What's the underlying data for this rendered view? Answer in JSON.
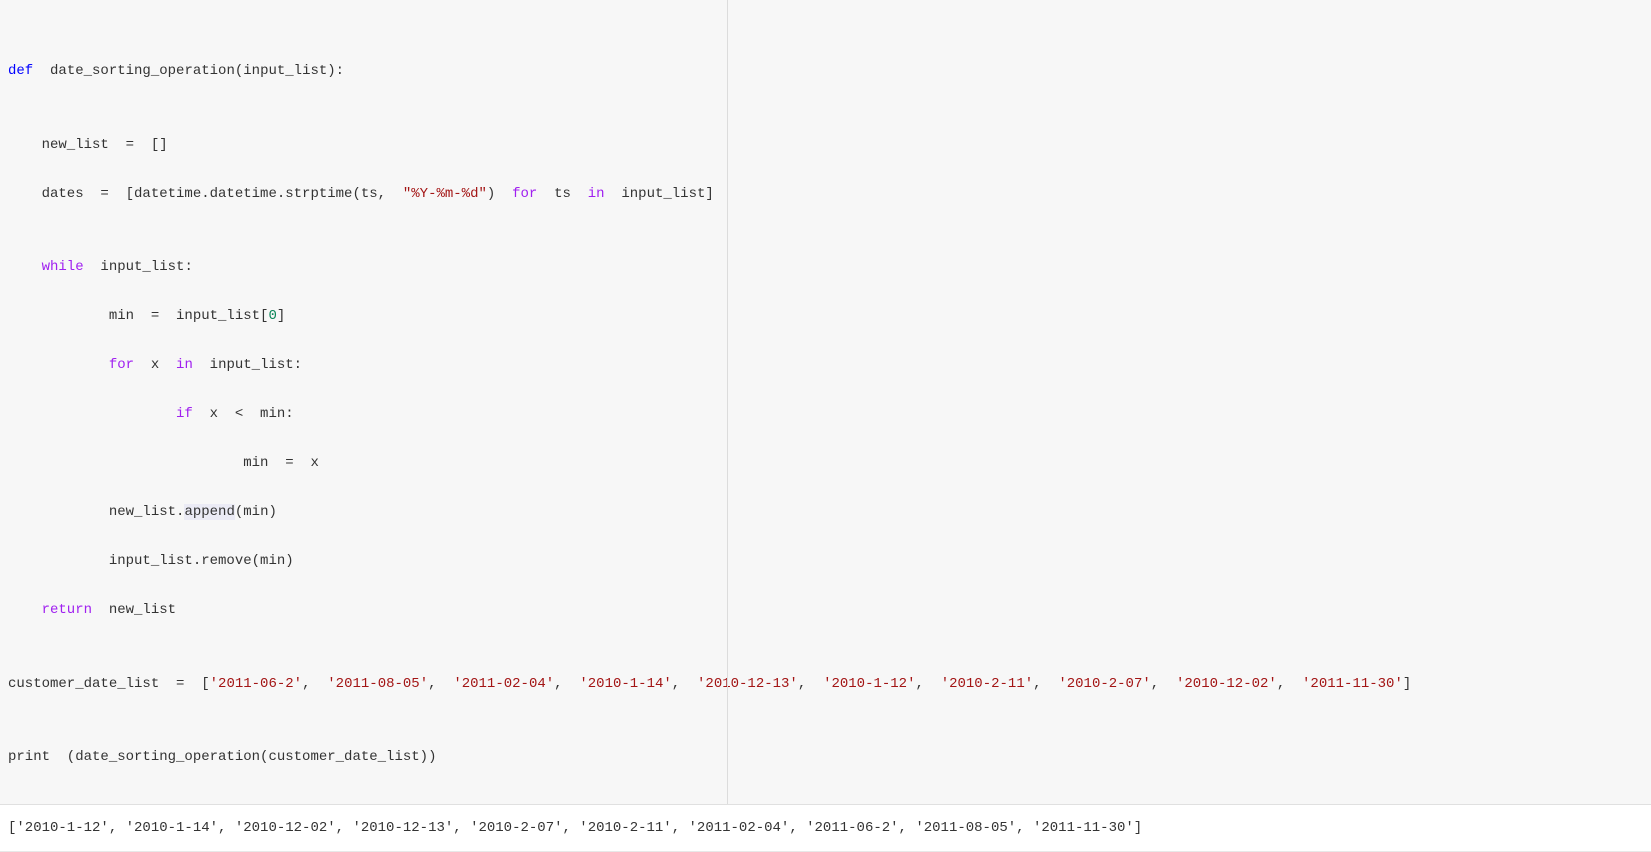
{
  "code": {
    "l1_def": "def",
    "l1_name": "  date_sorting_operation",
    "l1_rest": "(input_list):",
    "l2": "",
    "l3_a": "    new_list  =  []",
    "l4_a": "    dates  =  [datetime.datetime.strptime(ts,  ",
    "l4_str": "\"%Y-%m-%d\"",
    "l4_b": ")  ",
    "l4_for": "for",
    "l4_c": "  ts  ",
    "l4_in": "in",
    "l4_d": "  input_list]",
    "l5": "",
    "l6_while": "    while",
    "l6_rest": "  input_list:",
    "l7_a": "            min  =  input_list[",
    "l7_num": "0",
    "l7_b": "]",
    "l8_for": "            for",
    "l8_a": "  x  ",
    "l8_in": "in",
    "l8_b": "  input_list:",
    "l9_if": "                    if",
    "l9_rest": "  x  <  min:",
    "l10": "                            min  =  x",
    "l11_a": "            new_list.",
    "l11_hl": "append",
    "l11_b": "(min)",
    "l12": "            input_list.remove(min)",
    "l13_ret": "    return",
    "l13_rest": "  new_list",
    "l14": "",
    "l15_a": "customer_date_list  =  [",
    "l15_s1": "'2011-06-2'",
    "l15_c1": ",  ",
    "l15_s2": "'2011-08-05'",
    "l15_c2": ",  ",
    "l15_s3": "'2011-02-04'",
    "l15_c3": ",  ",
    "l15_s4": "'2010-1-14'",
    "l15_c4": ",  ",
    "l15_s5": "'2010-12-13'",
    "l15_c5": ",  ",
    "l15_s6": "'2010-1-12'",
    "l15_c6": ",  ",
    "l15_s7": "'2010-2-11'",
    "l15_c7": ",  ",
    "l15_s8": "'2010-2-07'",
    "l15_c8": ",  ",
    "l15_s9": "'2010-12-02'",
    "l15_c9": ",  ",
    "l15_s10": "'2011-11-30'",
    "l15_end": "]",
    "l16": "",
    "l17": "print  (date_sorting_operation(customer_date_list))"
  },
  "output": "['2010-1-12', '2010-1-14', '2010-12-02', '2010-12-13', '2010-2-07', '2010-2-11', '2011-02-04', '2011-06-2', '2011-08-05', '2011-11-30']"
}
